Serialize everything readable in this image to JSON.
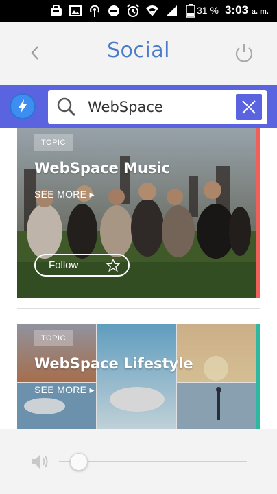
{
  "status_bar": {
    "battery_percent": "31 %",
    "time": "3:03",
    "ampm": "a. m."
  },
  "header": {
    "title": "Social",
    "back_icon": "chevron-left-icon",
    "power_icon": "power-icon"
  },
  "search": {
    "value": "WebSpace",
    "placeholder": "",
    "bolt_icon": "lightning-bolt-icon",
    "clear_icon": "close-icon"
  },
  "cards": [
    {
      "badge": "TOPIC",
      "title": "WebSpace Music",
      "see_more": "SEE MORE ▸",
      "follow_label": "Follow",
      "accent": "#f0605a",
      "image": "festival-crowd-photo"
    },
    {
      "badge": "TOPIC",
      "title": "WebSpace Lifestyle",
      "see_more": "SEE MORE ▸",
      "accent": "#2fb8a0",
      "image": "lifestyle-photo-collage"
    }
  ],
  "player": {
    "volume_icon": "volume-icon",
    "volume_level": 0.07
  },
  "colors": {
    "accent_blue": "#4a7cc7",
    "search_bar": "#5a63e0",
    "bolt_button": "#3d8ef0"
  }
}
